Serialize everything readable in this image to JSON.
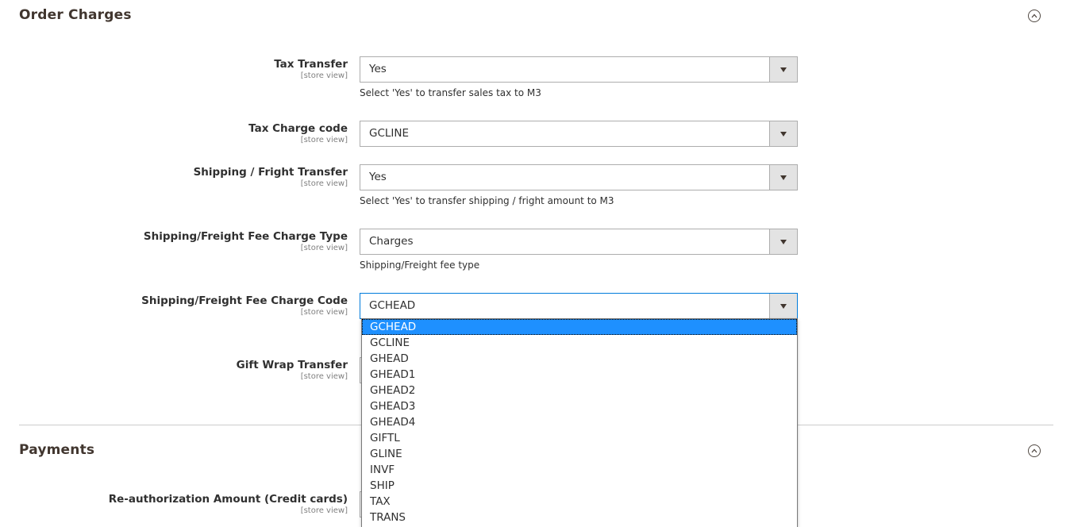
{
  "sections": {
    "order_charges": {
      "title": "Order Charges",
      "fields": [
        {
          "label": "Tax Transfer",
          "scope": "[store view]",
          "value": "Yes",
          "note": "Select 'Yes' to transfer sales tax to M3"
        },
        {
          "label": "Tax Charge code",
          "scope": "[store view]",
          "value": "GCLINE"
        },
        {
          "label": "Shipping / Fright Transfer",
          "scope": "[store view]",
          "value": "Yes",
          "note": "Select 'Yes' to transfer shipping / fright amount to M3"
        },
        {
          "label": "Shipping/Freight Fee Charge Type",
          "scope": "[store view]",
          "value": "Charges",
          "note": "Shipping/Freight fee type"
        },
        {
          "label": "Shipping/Freight Fee Charge Code",
          "scope": "[store view]",
          "value": "GCHEAD"
        },
        {
          "label": "Gift Wrap Transfer",
          "scope": "[store view]"
        }
      ]
    },
    "payments": {
      "title": "Payments",
      "fields": [
        {
          "label": "Re-authorization Amount (Credit cards)",
          "scope": "[store view]"
        }
      ]
    }
  },
  "dropdown": {
    "selected": "GCHEAD",
    "options": [
      "GCHEAD",
      "GCLINE",
      "GHEAD",
      "GHEAD1",
      "GHEAD2",
      "GHEAD3",
      "GHEAD4",
      "GIFTL",
      "GLINE",
      "INVF",
      "SHIP",
      "TAX",
      "TRANS"
    ]
  },
  "icons": {
    "collapse": "chevron-up-circle-icon",
    "select_arrow": "caret-down-icon"
  },
  "colors": {
    "selected_option_bg": "#1e90ff",
    "focus_border": "#007bdb"
  }
}
